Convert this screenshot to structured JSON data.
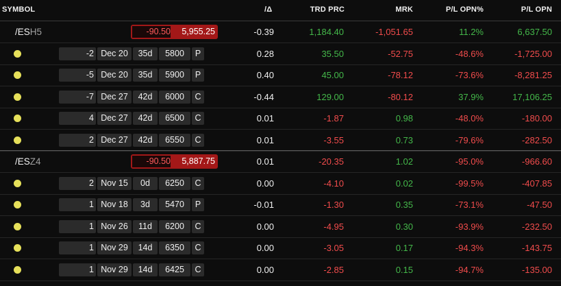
{
  "header": {
    "symbol": "SYMBOL",
    "delta": "/Δ",
    "trd_prc": "TRD PRC",
    "mrk": "MRK",
    "pl_opn_pct": "P/L OPN%",
    "pl_opn": "P/L OPN"
  },
  "colors": {
    "profit": "#44b84a",
    "loss": "#f24c4c",
    "position_dot": "#e6e05a",
    "mark_box": "#a31818"
  },
  "groups": [
    {
      "symbol_root": "/ES",
      "symbol_suffix": "H5",
      "net_change": "-90.50",
      "last_price": "5,955.25",
      "delta": "-0.39",
      "trd_prc": "1,184.40",
      "mrk": "-1,051.65",
      "pl_pct": "11.2%",
      "pl": "6,637.50",
      "legs": [
        {
          "qty": "-2",
          "exp": "Dec 20",
          "dte": "35d",
          "strike": "5800",
          "type": "P",
          "delta": "0.28",
          "trd_prc": "35.50",
          "mrk": "-52.75",
          "pl_pct": "-48.6%",
          "pl": "-1,725.00"
        },
        {
          "qty": "-5",
          "exp": "Dec 20",
          "dte": "35d",
          "strike": "5900",
          "type": "P",
          "delta": "0.40",
          "trd_prc": "45.00",
          "mrk": "-78.12",
          "pl_pct": "-73.6%",
          "pl": "-8,281.25"
        },
        {
          "qty": "-7",
          "exp": "Dec 27",
          "dte": "42d",
          "strike": "6000",
          "type": "C",
          "delta": "-0.44",
          "trd_prc": "129.00",
          "mrk": "-80.12",
          "pl_pct": "37.9%",
          "pl": "17,106.25"
        },
        {
          "qty": "4",
          "exp": "Dec 27",
          "dte": "42d",
          "strike": "6500",
          "type": "C",
          "delta": "0.01",
          "trd_prc": "-1.87",
          "mrk": "0.98",
          "pl_pct": "-48.0%",
          "pl": "-180.00"
        },
        {
          "qty": "2",
          "exp": "Dec 27",
          "dte": "42d",
          "strike": "6550",
          "type": "C",
          "delta": "0.01",
          "trd_prc": "-3.55",
          "mrk": "0.73",
          "pl_pct": "-79.6%",
          "pl": "-282.50"
        }
      ]
    },
    {
      "symbol_root": "/ES",
      "symbol_suffix": "Z4",
      "net_change": "-90.50",
      "last_price": "5,887.75",
      "delta": "0.01",
      "trd_prc": "-20.35",
      "mrk": "1.02",
      "pl_pct": "-95.0%",
      "pl": "-966.60",
      "legs": [
        {
          "qty": "2",
          "exp": "Nov 15",
          "dte": "0d",
          "strike": "6250",
          "type": "C",
          "delta": "0.00",
          "trd_prc": "-4.10",
          "mrk": "0.02",
          "pl_pct": "-99.5%",
          "pl": "-407.85"
        },
        {
          "qty": "1",
          "exp": "Nov 18",
          "dte": "3d",
          "strike": "5470",
          "type": "P",
          "delta": "-0.01",
          "trd_prc": "-1.30",
          "mrk": "0.35",
          "pl_pct": "-73.1%",
          "pl": "-47.50"
        },
        {
          "qty": "1",
          "exp": "Nov 26",
          "dte": "11d",
          "strike": "6200",
          "type": "C",
          "delta": "0.00",
          "trd_prc": "-4.95",
          "mrk": "0.30",
          "pl_pct": "-93.9%",
          "pl": "-232.50"
        },
        {
          "qty": "1",
          "exp": "Nov 29",
          "dte": "14d",
          "strike": "6350",
          "type": "C",
          "delta": "0.00",
          "trd_prc": "-3.05",
          "mrk": "0.17",
          "pl_pct": "-94.3%",
          "pl": "-143.75"
        },
        {
          "qty": "1",
          "exp": "Nov 29",
          "dte": "14d",
          "strike": "6425",
          "type": "C",
          "delta": "0.00",
          "trd_prc": "-2.85",
          "mrk": "0.15",
          "pl_pct": "-94.7%",
          "pl": "-135.00"
        }
      ]
    }
  ]
}
